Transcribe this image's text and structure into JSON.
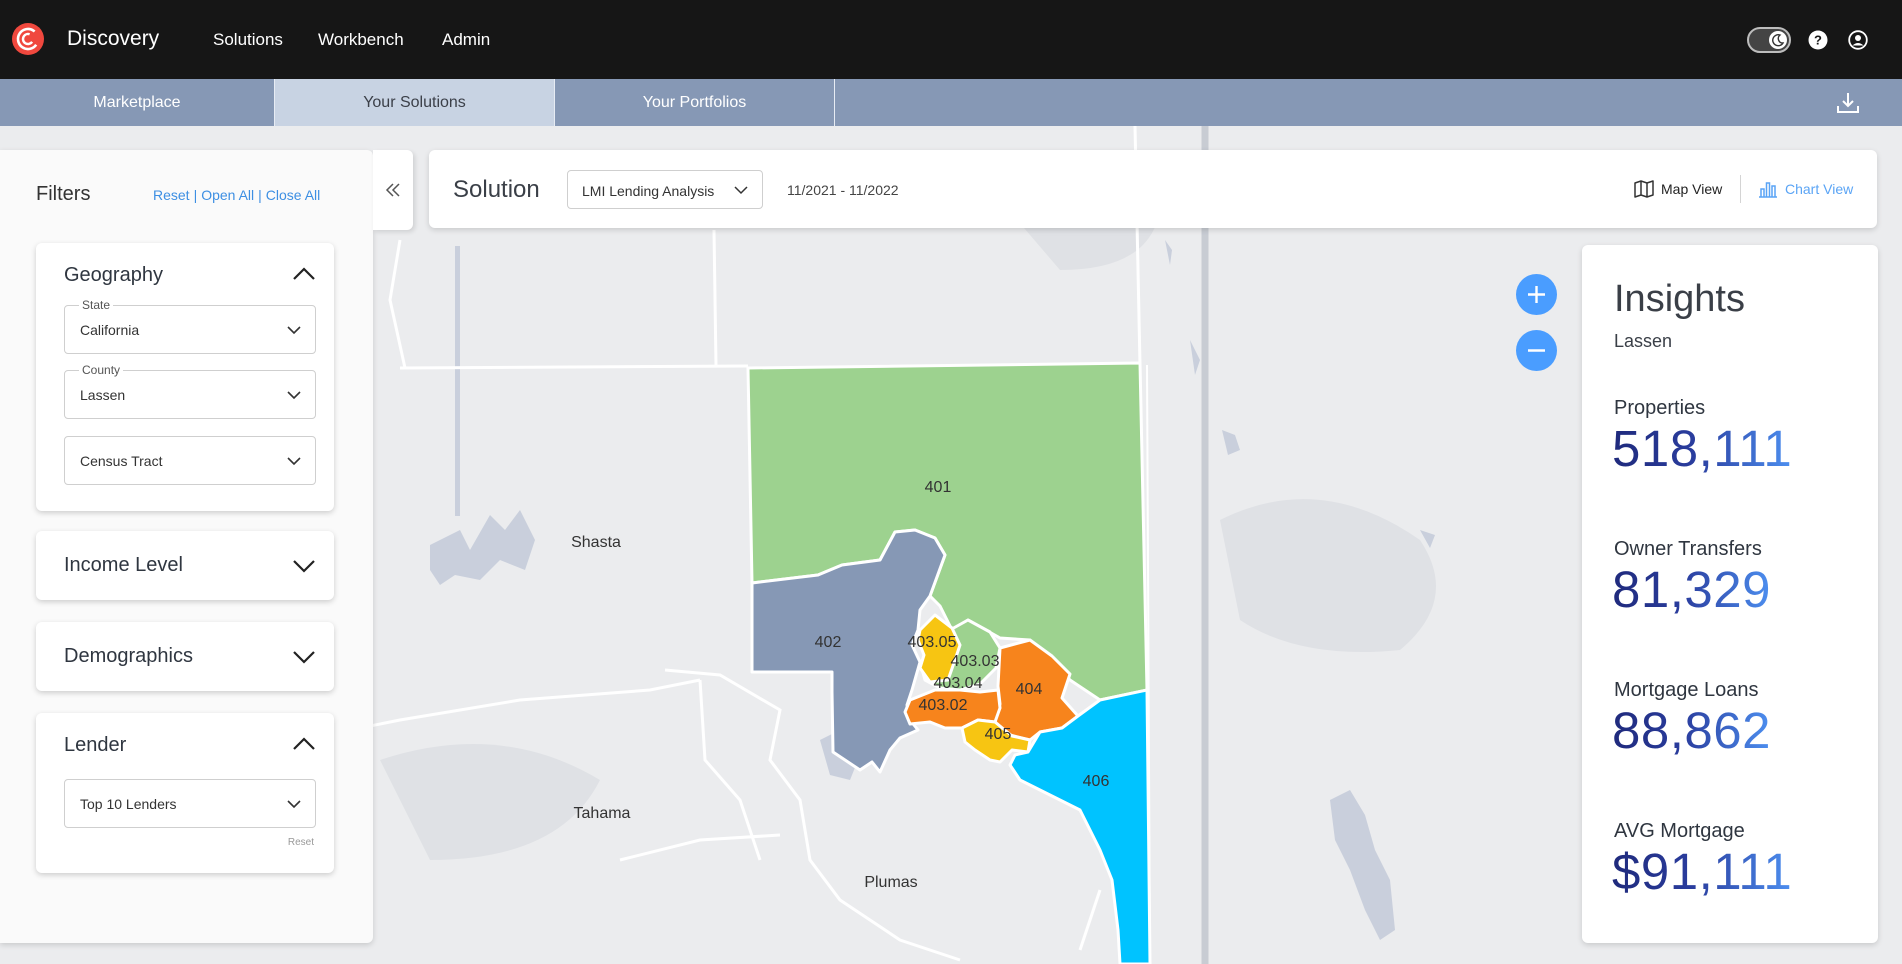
{
  "header": {
    "brand": "Discovery",
    "nav": [
      "Solutions",
      "Workbench",
      "Admin"
    ]
  },
  "tabs": [
    {
      "label": "Marketplace",
      "active": false
    },
    {
      "label": "Your Solutions",
      "active": true
    },
    {
      "label": "Your Portfolios",
      "active": false
    }
  ],
  "filters": {
    "title": "Filters",
    "links": {
      "reset": "Reset",
      "open_all": "Open All",
      "close_all": "Close All",
      "separator": "|"
    },
    "geography": {
      "title": "Geography",
      "state_label": "State",
      "state_value": "California",
      "county_label": "County",
      "county_value": "Lassen",
      "tract_value": "Census Tract"
    },
    "income": {
      "title": "Income Level"
    },
    "demographics": {
      "title": "Demographics"
    },
    "lender": {
      "title": "Lender",
      "value": "Top 10 Lenders",
      "reset": "Reset"
    }
  },
  "solution_bar": {
    "title": "Solution",
    "selected": "LMI Lending Analysis",
    "date_range": "11/2021 - 11/2022",
    "map_view": "Map View",
    "chart_view": "Chart View"
  },
  "map": {
    "county_labels": [
      "Shasta",
      "Tahama",
      "Plumas"
    ],
    "tracts": [
      {
        "id": "401",
        "color": "#9dd28f"
      },
      {
        "id": "402",
        "color": "#8698b5"
      },
      {
        "id": "403.05",
        "color": "#f7c512"
      },
      {
        "id": "403.03",
        "color": "#9dd28f"
      },
      {
        "id": "403.04",
        "color": "#f7c512"
      },
      {
        "id": "403.02",
        "color": "#f7841c"
      },
      {
        "id": "404",
        "color": "#f7841c"
      },
      {
        "id": "405",
        "color": "#f7c512"
      },
      {
        "id": "406",
        "color": "#00c3ff"
      }
    ]
  },
  "insights": {
    "title": "Insights",
    "subtitle": "Lassen",
    "metrics": [
      {
        "label": "Properties",
        "value": "518,111"
      },
      {
        "label": "Owner Transfers",
        "value": "81,329"
      },
      {
        "label": "Mortgage Loans",
        "value": "88,862"
      },
      {
        "label": "AVG Mortgage",
        "value": "$91,111"
      }
    ]
  },
  "colors": {
    "topbar": "#161616",
    "tabbar": "#8698b5",
    "tab_active": "#c8d3e3",
    "accent": "#3d8fe3",
    "zoom": "#4a9dff"
  }
}
